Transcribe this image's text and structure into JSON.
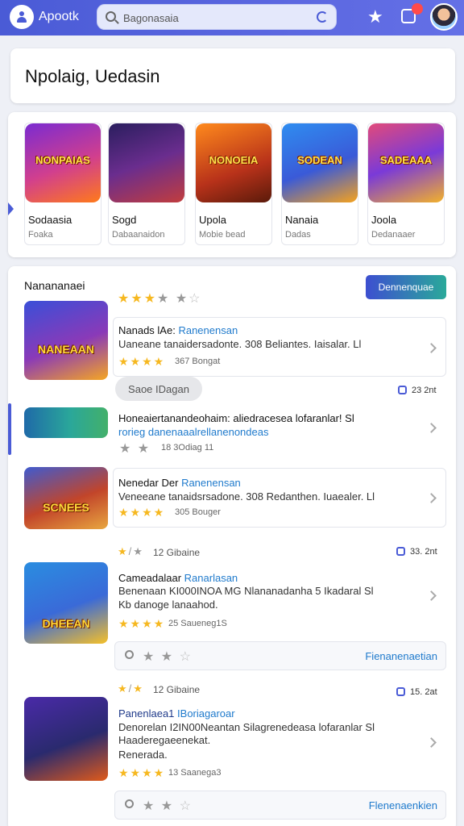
{
  "header": {
    "app_name": "Apootk",
    "search_value": "Bagonasaia",
    "colors": {
      "primary": "#4a5bd6",
      "accent": "#2aa99a",
      "star": "#f6b820",
      "link": "#1f7acc"
    },
    "icons": [
      "user-icon",
      "search-icon",
      "refresh-icon",
      "star-icon",
      "notification-icon",
      "avatar"
    ]
  },
  "hero": {
    "title": "Npolaig, Uedasin"
  },
  "featured": {
    "tiles": [
      {
        "art": "NONPAIAS",
        "name": "Sodaasia",
        "sub": "Foaka",
        "colors": [
          "#7a2bd1",
          "#ff7a1a"
        ]
      },
      {
        "art": "",
        "name": "Sogd",
        "sub": "Dabaanaidon",
        "colors": [
          "#2a1e5e",
          "#c23d3d"
        ]
      },
      {
        "art": "NONOEIA",
        "name": "Upola",
        "sub": "Mobie bead",
        "colors": [
          "#ff8a1c",
          "#d8421a"
        ]
      },
      {
        "art": "SODEAN",
        "name": "Nanaia",
        "sub": "Dadas",
        "colors": [
          "#2f8df0",
          "#f6a21d"
        ]
      },
      {
        "art": "SADEAAA",
        "name": "Joola",
        "sub": "Dedanaaer",
        "colors": [
          "#e24a7a",
          "#f2b12b"
        ]
      }
    ]
  },
  "list": {
    "heading": "Nanananaei",
    "heading_rating": 3,
    "primary_button": "Dennenquae",
    "items": [
      {
        "title": "Nanads lAe:",
        "tag": "Ranenensan",
        "desc": "Uaneane tanaidersadonte. 308 Beliantes. Iaisalar. Ll",
        "rating": 4,
        "meta": "367 Bongat",
        "art": "NANEAAN",
        "colors": [
          "#3a4fd8",
          "#f5a623"
        ]
      },
      {
        "title": "Honeaiertanandeohaim:",
        "title_extra": "aliedracesea lofaranlar! Sl",
        "desc": "rorieg danenaaalrellanenondeas",
        "rating": 2,
        "meta": "18 3Odiag 11",
        "colors": [
          "#1f6aa8",
          "#43b06a"
        ]
      },
      {
        "title": "Nenedar Der",
        "tag": "Ranenensan",
        "desc": "Veneeane tanaidsrsadone. 308 Redanthen. Iuaealer. Ll",
        "rating": 4,
        "meta": "305 Bouger",
        "art": "SCNEES",
        "colors": [
          "#3f5bd0",
          "#e8a640"
        ]
      },
      {
        "top_meta": "12 Gibaine",
        "count": "33. 2nt",
        "title": "Cameadalaar",
        "tag": "Ranarlasan",
        "desc": "Benenaan KI000INOA MG Nlananadanha 5 Ikadaral Sl",
        "desc2": "Kb danoge lanaahod.",
        "rating": 4,
        "meta": "25 Saueneg1S",
        "art": "DHEEAN",
        "colors": [
          "#2a8de0",
          "#f6c028"
        ],
        "review_link": "Fienanenaetian"
      },
      {
        "top_meta": "12 Gibaine",
        "count": "15. 2at",
        "title": "Panenlaea1",
        "tag": "IBoriagaroar",
        "desc": "Denorelan I2IN00Neantan Silagrenedeasa lofaranlar Sl",
        "desc2": "Haaderegaeenekat.",
        "desc3": "Renerada.",
        "rating": 4,
        "meta": "13 Saanega3",
        "colors": [
          "#4a2aa8",
          "#e05a1a"
        ],
        "review_link": "Flenenaenkien"
      }
    ],
    "chip_button": "Saoe IDagan",
    "first_count": "23 2nt"
  }
}
